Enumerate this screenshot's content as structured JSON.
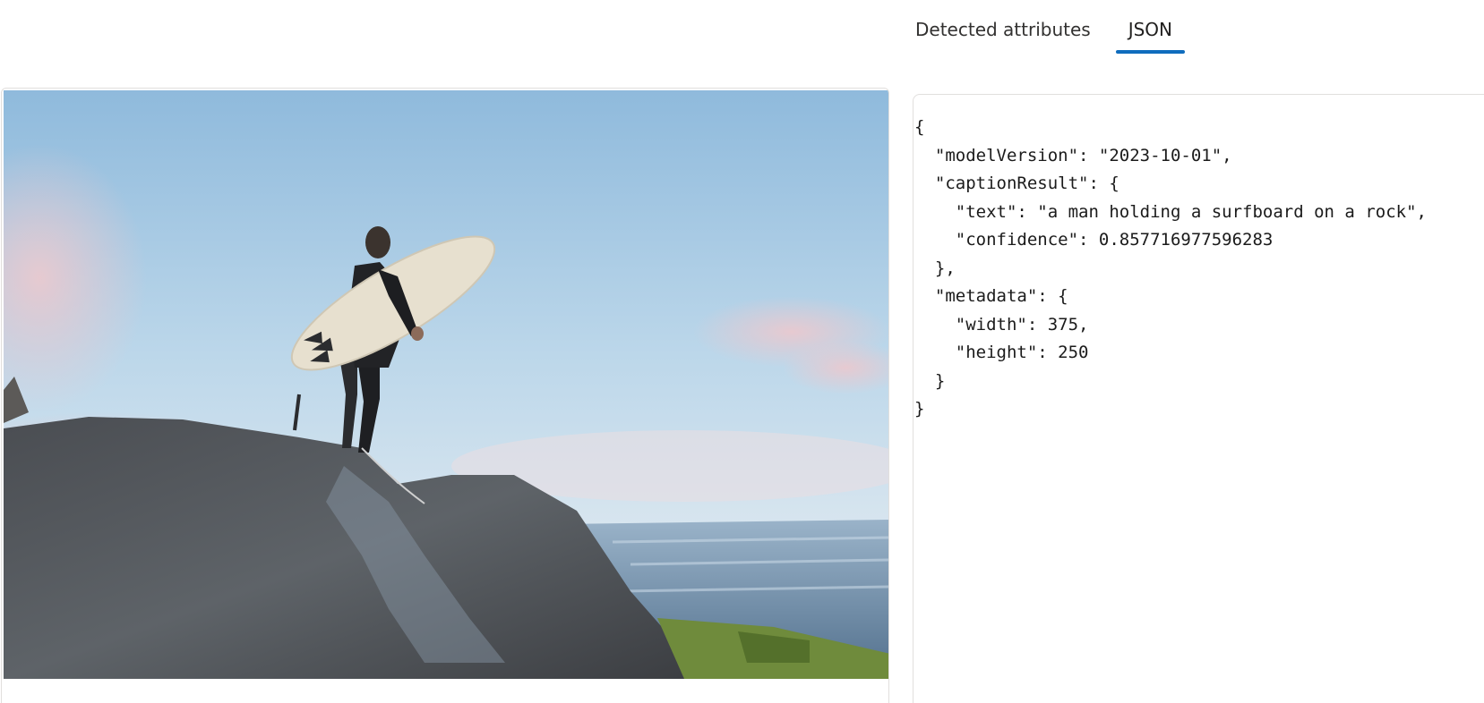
{
  "tabs": {
    "detected_attributes": "Detected attributes",
    "json": "JSON",
    "active": "JSON"
  },
  "image": {
    "alt": "a man holding a surfboard on a rock"
  },
  "json_view": {
    "lines": [
      "{",
      "  \"modelVersion\": \"2023-10-01\",",
      "  \"captionResult\": {",
      "    \"text\": \"a man holding a surfboard on a rock\",",
      "    \"confidence\": 0.857716977596283",
      "  },",
      "  \"metadata\": {",
      "    \"width\": 375,",
      "    \"height\": 250",
      "  }",
      "}"
    ]
  },
  "colors": {
    "accent": "#0f6cbd",
    "border": "#e1dfdd"
  }
}
